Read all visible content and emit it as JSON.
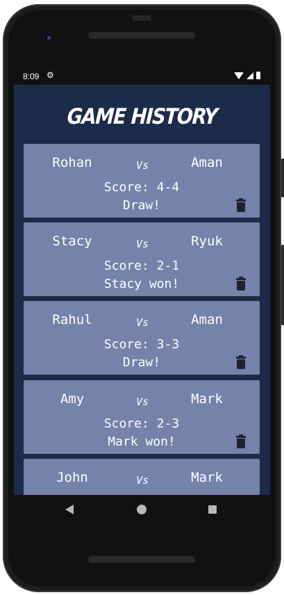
{
  "status_bar": {
    "time": "8:09",
    "settings_icon": "gear-icon"
  },
  "app": {
    "title": "GAME HISTORY"
  },
  "games": [
    {
      "player1": "Rohan",
      "vs": "Vs",
      "player2": "Aman",
      "score": "Score: 4-4",
      "result": "Draw!"
    },
    {
      "player1": "Stacy",
      "vs": "Vs",
      "player2": "Ryuk",
      "score": "Score: 2-1",
      "result": "Stacy won!"
    },
    {
      "player1": "Rahul",
      "vs": "Vs",
      "player2": "Aman",
      "score": "Score: 3-3",
      "result": "Draw!"
    },
    {
      "player1": "Amy",
      "vs": "Vs",
      "player2": "Mark",
      "score": "Score: 2-3",
      "result": "Mark won!"
    },
    {
      "player1": "John",
      "vs": "Vs",
      "player2": "Mark",
      "score": "",
      "result": ""
    }
  ],
  "nav": {
    "back_icon": "back-triangle-icon",
    "home_icon": "home-circle-icon",
    "recents_icon": "recents-square-icon"
  },
  "colors": {
    "background": "#1d2b4b",
    "card": "#7582aa",
    "text": "#ffffff",
    "trash": "#1f2231"
  }
}
